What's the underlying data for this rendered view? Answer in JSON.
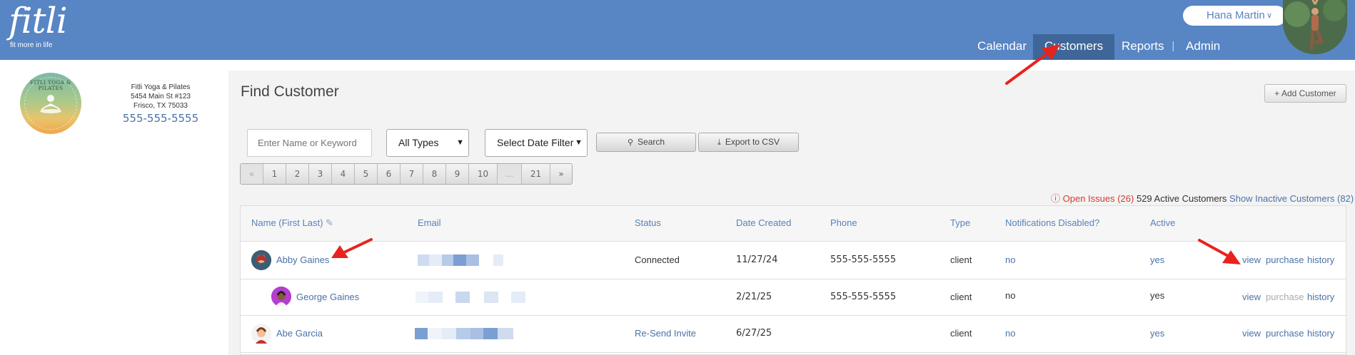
{
  "app": {
    "logo_text": "fitli",
    "logo_tagline": "fit more in life"
  },
  "user": {
    "name": "Hana Martin",
    "chevron_icon": "chevron-down-icon"
  },
  "nav": {
    "items": [
      {
        "label": "Calendar"
      },
      {
        "label": "Customers",
        "active": true
      },
      {
        "label": "Reports"
      },
      {
        "label": "Admin"
      }
    ],
    "separator": "|"
  },
  "studio": {
    "logo_text": "FITLI YOGA & PILATES",
    "name": "Fitli Yoga & Pilates",
    "address_line1": "5454 Main St #123",
    "address_line2": "Frisco, TX 75033",
    "phone": "555-555-5555"
  },
  "page": {
    "title": "Find Customer",
    "add_button": "+ Add Customer"
  },
  "filters": {
    "search_placeholder": "Enter Name or Keyword",
    "type_select": "All Types",
    "date_select": "Select Date Filter",
    "search_button": "Search",
    "export_button": "Export to CSV"
  },
  "pagination": {
    "prev": "«",
    "pages": [
      "1",
      "2",
      "3",
      "4",
      "5",
      "6",
      "7",
      "8",
      "9",
      "10"
    ],
    "ellipsis": "...",
    "last": "21",
    "next": "»"
  },
  "summary": {
    "open_issues": "Open Issues (26)",
    "active": "529 Active Customers",
    "inactive_link": "Show Inactive Customers (82)"
  },
  "table": {
    "columns": [
      "Name (First Last)",
      "Email",
      "Status",
      "Date Created",
      "Phone",
      "Type",
      "Notifications Disabled?",
      "Active"
    ],
    "rows": [
      {
        "name": "Abby Gaines",
        "status": "Connected",
        "date": "11/27/24",
        "phone": "555-555-5555",
        "type": "client",
        "notifications": "no",
        "active": "yes",
        "actions": [
          "view",
          "purchase",
          "history"
        ]
      },
      {
        "name": "George Gaines",
        "status": "",
        "date": "2/21/25",
        "phone": "555-555-5555",
        "type": "client",
        "notifications": "no",
        "active": "yes",
        "actions": [
          "view",
          "purchase",
          "history"
        ]
      },
      {
        "name": "Abe Garcia",
        "status": "Re-Send Invite",
        "date": "6/27/25",
        "phone": "",
        "type": "client",
        "notifications": "no",
        "active": "yes",
        "actions": [
          "view",
          "purchase",
          "history"
        ]
      }
    ]
  },
  "colors": {
    "header": "#5885c3",
    "header_active": "#3f6698",
    "link": "#4a72a8",
    "alert": "#d83a2f",
    "annotation": "#e8231d"
  }
}
